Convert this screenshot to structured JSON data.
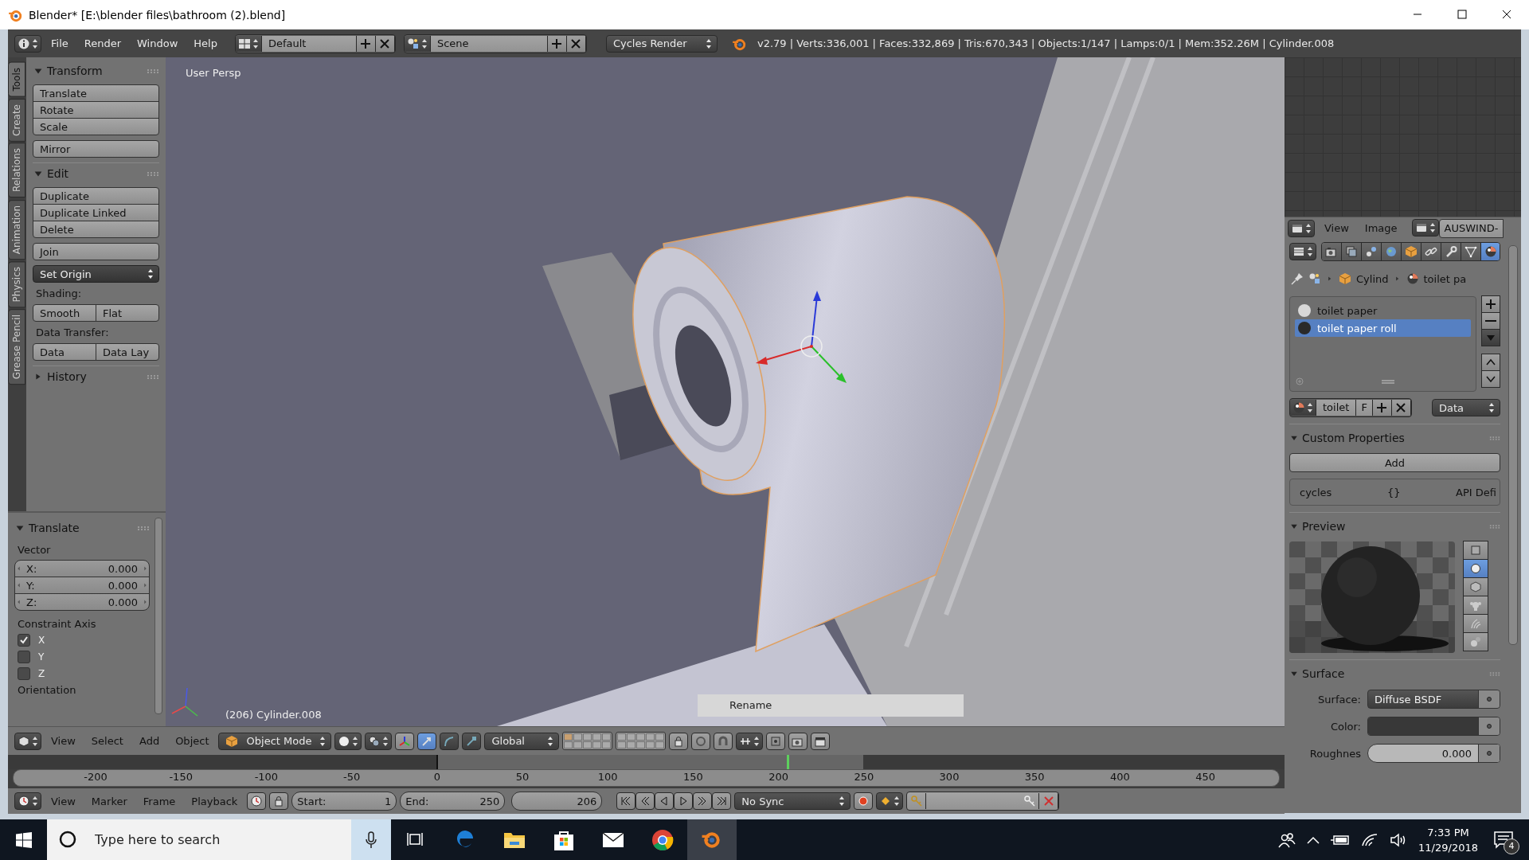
{
  "window": {
    "title": "Blender* [E:\\blender files\\bathroom (2).blend]"
  },
  "info_header": {
    "menus": [
      "File",
      "Render",
      "Window",
      "Help"
    ],
    "screen_layout": "Default",
    "scene": "Scene",
    "render_engine": "Cycles Render",
    "stats": "v2.79 | Verts:336,001 | Faces:332,869 | Tris:670,343 | Objects:1/147 | Lamps:0/1 | Mem:352.26M | Cylinder.008"
  },
  "tool_shelf": {
    "tabs": [
      {
        "label": "Tools",
        "selected": true
      },
      {
        "label": "Create",
        "selected": false
      },
      {
        "label": "Relations",
        "selected": false
      },
      {
        "label": "Animation",
        "selected": false
      },
      {
        "label": "Physics",
        "selected": false
      },
      {
        "label": "Grease Pencil",
        "selected": false
      }
    ],
    "panels": [
      {
        "title": "Transform",
        "expanded": true,
        "rows": [
          {
            "kind": "column",
            "buttons": [
              "Translate",
              "Rotate",
              "Scale"
            ]
          },
          {
            "kind": "column",
            "buttons": [
              "Mirror"
            ]
          }
        ]
      },
      {
        "title": "Edit",
        "expanded": true,
        "rows": [
          {
            "kind": "column",
            "buttons": [
              "Duplicate",
              "Duplicate Linked",
              "Delete"
            ]
          },
          {
            "kind": "column",
            "buttons": [
              "Join"
            ]
          },
          {
            "kind": "dropdown",
            "value": "Set Origin"
          },
          {
            "kind": "label",
            "text": "Shading:"
          },
          {
            "kind": "row",
            "buttons": [
              "Smooth",
              "Flat"
            ]
          },
          {
            "kind": "label",
            "text": "Data Transfer:"
          },
          {
            "kind": "row",
            "buttons": [
              "Data",
              "Data Lay"
            ]
          }
        ]
      },
      {
        "title": "History",
        "expanded": false
      }
    ]
  },
  "operator_panel": {
    "title": "Translate",
    "expanded": true,
    "vector_label": "Vector",
    "fields": [
      {
        "label": "X:",
        "value": "0.000"
      },
      {
        "label": "Y:",
        "value": "0.000"
      },
      {
        "label": "Z:",
        "value": "0.000"
      }
    ],
    "constraint_label": "Constraint Axis",
    "axes": [
      {
        "label": "X",
        "checked": true
      },
      {
        "label": "Y",
        "checked": false
      },
      {
        "label": "Z",
        "checked": false
      }
    ],
    "orientation_label": "Orientation"
  },
  "viewport": {
    "view_name": "User Persp",
    "object_label": "(206) Cylinder.008",
    "popup": "Rename"
  },
  "view3d_header": {
    "menus": [
      "View",
      "Select",
      "Add",
      "Object"
    ],
    "mode": "Object Mode",
    "manipulators": [
      {
        "kind": "translate",
        "selected": true
      },
      {
        "kind": "rotate",
        "selected": false
      },
      {
        "kind": "scale",
        "selected": false
      }
    ],
    "orientation": "Global"
  },
  "timeline": {
    "ticks": [
      "-200",
      "-150",
      "-100",
      "-50",
      "0",
      "50",
      "100",
      "150",
      "200",
      "250",
      "300",
      "350",
      "400",
      "450"
    ],
    "header": {
      "menus": [
        "View",
        "Marker",
        "Frame",
        "Playback"
      ],
      "start_label": "Start:",
      "start": "1",
      "end_label": "End:",
      "end": "250",
      "current": "206",
      "sync": "No Sync"
    }
  },
  "image_editor": {
    "menus": [
      "View",
      "Image"
    ],
    "image_name": "AUSWIND-"
  },
  "properties": {
    "context_tabs": [
      {
        "kind": "render",
        "selected": false
      },
      {
        "kind": "layers",
        "selected": false
      },
      {
        "kind": "scene",
        "selected": false
      },
      {
        "kind": "world",
        "selected": false
      },
      {
        "kind": "object",
        "selected": false
      },
      {
        "kind": "constraints",
        "selected": false
      },
      {
        "kind": "modifiers",
        "selected": false
      },
      {
        "kind": "data",
        "selected": false
      },
      {
        "kind": "material",
        "selected": true
      }
    ],
    "breadcrumb": [
      "Cylind",
      "toilet pa"
    ],
    "material_slots": [
      {
        "name": "toilet paper",
        "color": "#d8d8d8",
        "selected": false
      },
      {
        "name": "toilet paper roll",
        "color": "#2a2a2a",
        "selected": true
      }
    ],
    "material_name": "toilet",
    "fake_user": "F",
    "link": "Data",
    "custom_properties": {
      "title": "Custom Properties",
      "add_button": "Add",
      "property": {
        "name": "cycles",
        "value": "{}",
        "type": "API Defi"
      }
    },
    "preview": {
      "title": "Preview",
      "shapes": [
        {
          "kind": "flat",
          "selected": false
        },
        {
          "kind": "sphere",
          "selected": true
        },
        {
          "kind": "cube",
          "selected": false
        },
        {
          "kind": "monkey",
          "selected": false
        },
        {
          "kind": "hair",
          "selected": false
        },
        {
          "kind": "spheres",
          "selected": false
        }
      ]
    },
    "surface": {
      "title": "Surface",
      "rows": [
        {
          "kind": "dropdown",
          "label": "Surface:",
          "value": "Diffuse BSDF"
        },
        {
          "kind": "color",
          "label": "Color:",
          "color": "#383838"
        },
        {
          "kind": "slider",
          "label": "Roughnes",
          "value": "0.000"
        }
      ]
    }
  },
  "taskbar": {
    "search_placeholder": "Type here to search",
    "time": "7:33 PM",
    "date": "11/29/2018",
    "notifications": "4"
  }
}
